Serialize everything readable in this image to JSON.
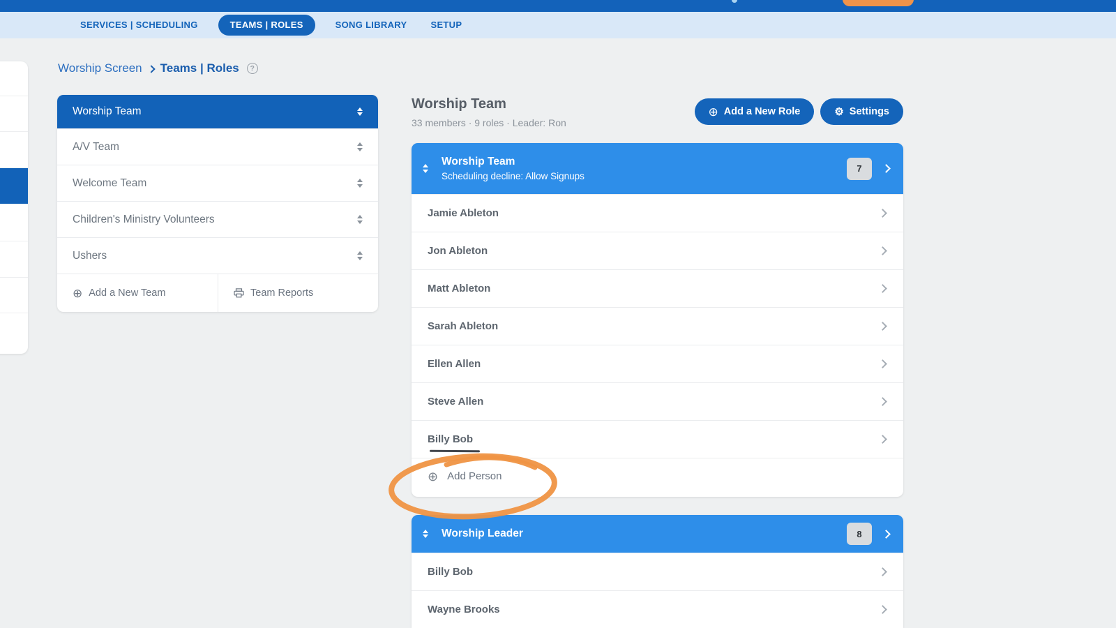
{
  "nav": {
    "tabs": [
      {
        "label": "SERVICES | SCHEDULING",
        "active": false
      },
      {
        "label": "TEAMS | ROLES",
        "active": true
      },
      {
        "label": "SONG LIBRARY",
        "active": false
      },
      {
        "label": "SETUP",
        "active": false
      }
    ]
  },
  "breadcrumb": {
    "parent": "Worship Screen",
    "current": "Teams | Roles"
  },
  "teams_panel": {
    "items": [
      {
        "name": "Worship Team",
        "selected": true
      },
      {
        "name": "A/V Team",
        "selected": false
      },
      {
        "name": "Welcome Team",
        "selected": false
      },
      {
        "name": "Children's Ministry Volunteers",
        "selected": false
      },
      {
        "name": "Ushers",
        "selected": false
      }
    ],
    "add_team_label": "Add a New Team",
    "team_reports_label": "Team Reports"
  },
  "main": {
    "title": "Worship Team",
    "subtitle": "33 members · 9 roles · Leader: Ron",
    "add_role_label": "Add a New Role",
    "settings_label": "Settings",
    "roles": [
      {
        "name": "Worship Team",
        "subtitle": "Scheduling decline: Allow Signups",
        "count": "7",
        "members": [
          "Jamie Ableton",
          "Jon Ableton",
          "Matt Ableton",
          "Sarah Ableton",
          "Ellen Allen",
          "Steve Allen",
          "Billy Bob"
        ],
        "add_person_label": "Add Person"
      },
      {
        "name": "Worship Leader",
        "count": "8",
        "members": [
          "Billy Bob",
          "Wayne Brooks"
        ]
      }
    ]
  },
  "icons": {
    "plus_circle": "⊕",
    "gear": "⚙",
    "question": "?"
  },
  "colors": {
    "topbar_blue": "#1362ba",
    "nav_bg": "#d9e8f8",
    "accent_blue": "#1464ba",
    "selected_team_blue": "#1262b8",
    "role_header_blue": "#2e8ee9",
    "badge_bg": "#d9dcdf",
    "annotation_orange": "#ef9343",
    "page_bg": "#eef0f1"
  }
}
